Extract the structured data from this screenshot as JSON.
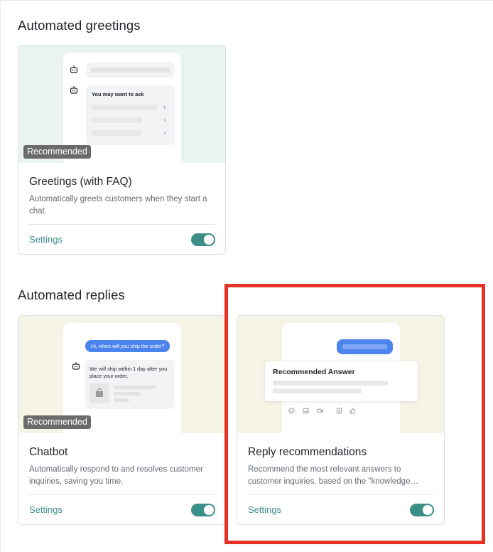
{
  "sections": {
    "greetings": {
      "title": "Automated greetings",
      "card": {
        "badge": "Recommended",
        "title": "Greetings (with FAQ)",
        "description": "Automatically greets customers when they start a chat.",
        "settings_label": "Settings",
        "enabled": true,
        "preview": {
          "ask_heading": "You may want to ask"
        }
      }
    },
    "replies": {
      "title": "Automated replies",
      "cards": [
        {
          "badge": "Recommended",
          "title": "Chatbot",
          "description": "Automatically respond to and resolves customer inquiries, saving you time.",
          "settings_label": "Settings",
          "enabled": true,
          "preview": {
            "question": "Hi, when will you ship the order?",
            "answer": "We will ship within 1 day after you place your order."
          }
        },
        {
          "badge": "",
          "title": "Reply recommendations",
          "description": "Recommend the most relevant answers to customer inquiries, based on the \"knowledge base\".",
          "settings_label": "Settings",
          "enabled": true,
          "preview": {
            "answer_heading": "Recommended Answer"
          }
        }
      ]
    }
  },
  "colors": {
    "accent": "#3b8f86",
    "highlight": "#e53224",
    "mint_bg": "#e9f3f1",
    "cream_bg": "#f6f4e6",
    "chat_blue": "#4c84ee"
  },
  "icons": [
    "bot-icon",
    "chevron-right-icon",
    "shopping-bag-icon",
    "emoji-icon",
    "image-icon",
    "video-icon",
    "file-icon",
    "thumbs-up-icon"
  ]
}
